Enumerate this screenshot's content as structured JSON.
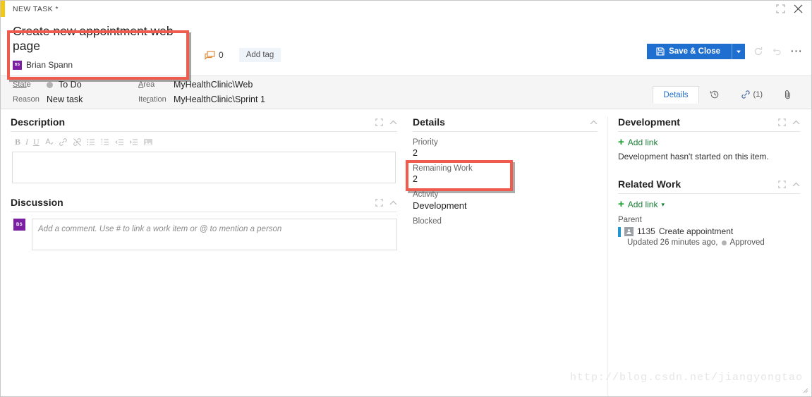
{
  "window": {
    "title": "NEW TASK *",
    "expand_icon": "expand-icon",
    "close_icon": "close-icon"
  },
  "header": {
    "work_item_title": "Create new appointment web page",
    "assignee": {
      "name": "Brian Spann",
      "initials": "BS",
      "avatar_color": "#7b1fa2"
    },
    "comment_count": "0",
    "comment_icon": "comment-icon",
    "add_tag_label": "Add tag",
    "save_button": {
      "label": "Save & Close",
      "color": "#1f6fd0",
      "icon": "save-icon"
    },
    "refresh_icon": "refresh-icon",
    "undo_icon": "undo-icon",
    "more_icon": "more-options-icon"
  },
  "fields": {
    "state_label": "State",
    "state_value": "To Do",
    "state_dot_color": "#b2b2b2",
    "reason_label": "Reason",
    "reason_value": "New task",
    "area_label": "Area",
    "area_value": "MyHealthClinic\\Web",
    "iteration_label": "Iteration",
    "iteration_value": "MyHealthClinic\\Sprint 1"
  },
  "tabs": [
    {
      "label": "Details",
      "active": true,
      "icon": ""
    },
    {
      "label": "",
      "active": false,
      "icon": "history-icon"
    },
    {
      "label": "(1)",
      "active": false,
      "icon": "link-icon"
    },
    {
      "label": "",
      "active": false,
      "icon": "attachment-icon"
    }
  ],
  "description": {
    "title": "Description",
    "expand_icon": "expand-icon",
    "collapse_icon": "chevron-up-icon",
    "toolbar": [
      "bold-icon",
      "italic-icon",
      "underline-icon",
      "highlight-icon",
      "link-icon",
      "unlink-icon",
      "bullet-list-icon",
      "numbered-list-icon",
      "outdent-icon",
      "indent-icon",
      "image-icon"
    ],
    "content": ""
  },
  "discussion": {
    "title": "Discussion",
    "expand_icon": "expand-icon",
    "collapse_icon": "chevron-up-icon",
    "avatar_initials": "BS",
    "placeholder": "Add a comment. Use # to link a work item or @ to mention a person"
  },
  "details": {
    "title": "Details",
    "collapse_icon": "chevron-up-icon",
    "priority_label": "Priority",
    "priority_value": "2",
    "remaining_work_label": "Remaining Work",
    "remaining_work_value": "2",
    "activity_label": "Activity",
    "activity_value": "Development",
    "blocked_label": "Blocked"
  },
  "development": {
    "title": "Development",
    "expand_icon": "expand-icon",
    "collapse_icon": "chevron-up-icon",
    "add_link_label": "Add link",
    "note": "Development hasn't started on this item."
  },
  "related_work": {
    "title": "Related Work",
    "expand_icon": "expand-icon",
    "collapse_icon": "chevron-up-icon",
    "add_link_label": "Add link",
    "parent_label": "Parent",
    "parent_id": "1135",
    "parent_title": "Create appointment",
    "parent_updated": "Updated 26 minutes ago,",
    "parent_state": "Approved"
  },
  "watermark": "http://blog.csdn.net/jiangyongtao",
  "highlights": {
    "title_box_color": "#ef5b4c",
    "remaining_work_box_color": "#ef5b4c"
  }
}
